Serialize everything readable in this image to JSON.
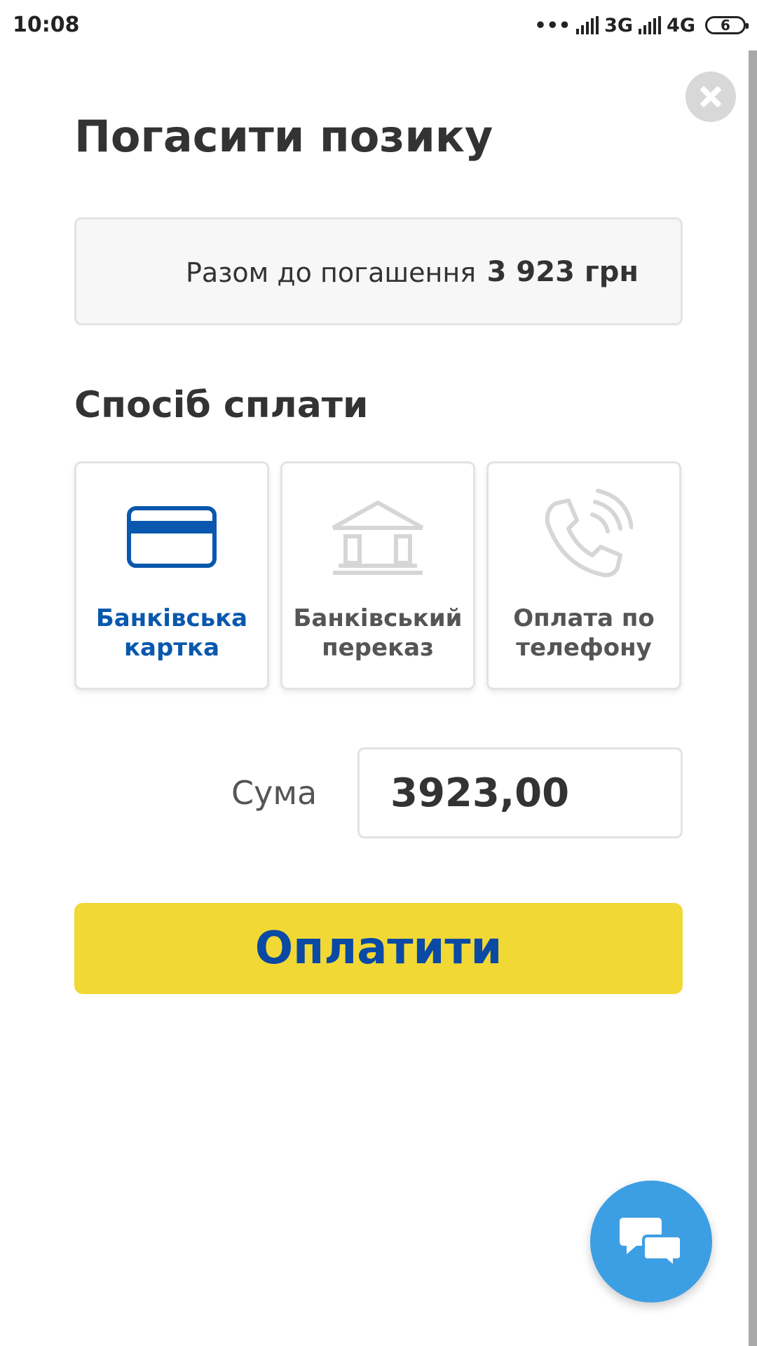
{
  "status_bar": {
    "time": "10:08",
    "dots": "•••",
    "network1": "3G",
    "network2": "4G",
    "battery": "6"
  },
  "header": {
    "title": "Погасити позику",
    "close_icon": "close-icon"
  },
  "total": {
    "label": "Разом до погашення",
    "value": "3 923 грн"
  },
  "payment_method": {
    "title": "Спосіб сплати",
    "options": [
      {
        "line1": "Банківська",
        "line2": "картка",
        "icon": "credit-card-icon",
        "selected": true
      },
      {
        "line1": "Банківський",
        "line2": "переказ",
        "icon": "bank-icon",
        "selected": false
      },
      {
        "line1": "Оплата по",
        "line2": "телефону",
        "icon": "phone-icon",
        "selected": false
      }
    ]
  },
  "amount": {
    "label": "Сума",
    "value": "3923,00"
  },
  "pay_button": {
    "label": "Оплатити"
  },
  "colors": {
    "accent_blue": "#0a58ad",
    "button_yellow": "#f2d834",
    "fab_blue": "#3d9fe3"
  }
}
